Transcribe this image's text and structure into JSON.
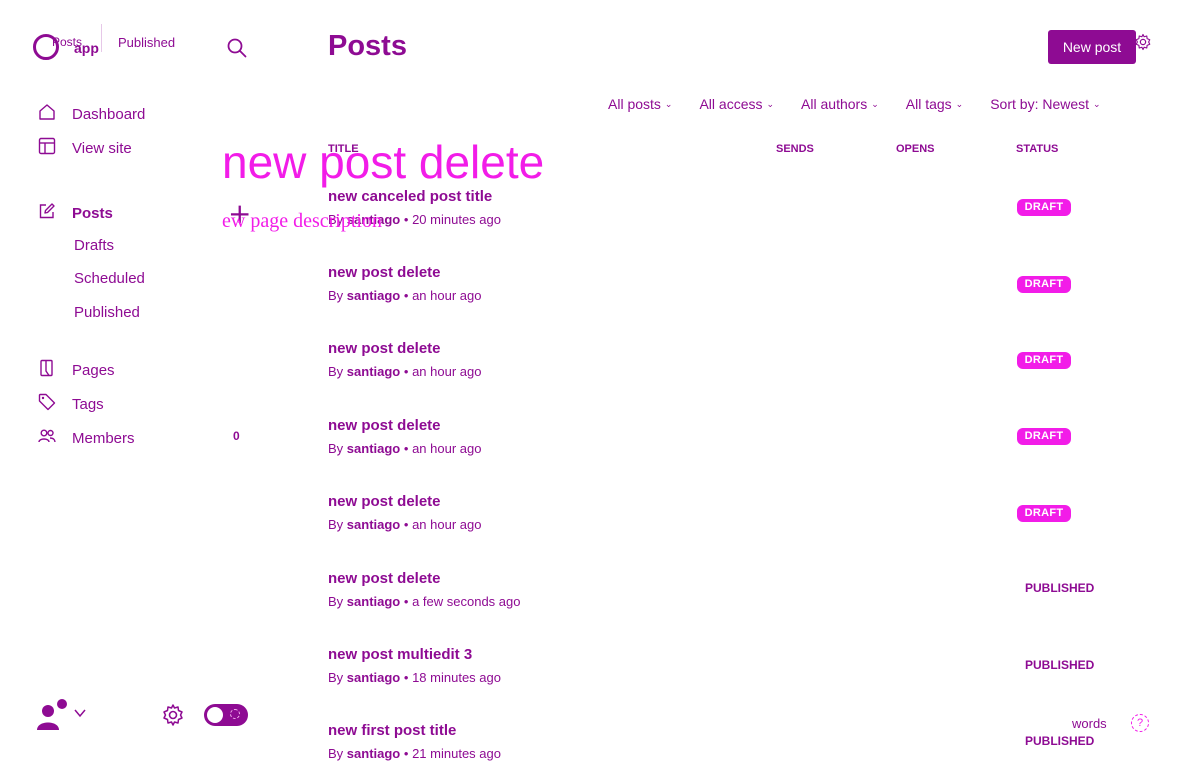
{
  "brand": {
    "app_label": "app",
    "crumb_posts": "Posts",
    "crumb_published": "Published",
    "accent": "#8e0b93",
    "highlight": "#f21ce8"
  },
  "sidebar": {
    "items": [
      {
        "label": "Dashboard",
        "icon": "home-icon"
      },
      {
        "label": "View site",
        "icon": "layout-icon"
      },
      {
        "label": "Posts",
        "icon": "edit-icon"
      },
      {
        "label": "Pages",
        "icon": "page-icon"
      },
      {
        "label": "Tags",
        "icon": "tag-icon"
      },
      {
        "label": "Members",
        "icon": "members-icon",
        "count": "0"
      }
    ],
    "sub_items": [
      "Drafts",
      "Scheduled",
      "Published"
    ]
  },
  "header": {
    "title": "Posts",
    "new_post_label": "New post"
  },
  "filters": [
    "All posts",
    "All access",
    "All authors",
    "All tags",
    "Sort by: Newest"
  ],
  "table": {
    "columns": [
      "TITLE",
      "SENDS",
      "OPENS",
      "STATUS"
    ],
    "rows": [
      {
        "title": "new canceled post title",
        "by": "By",
        "author": "santiago",
        "time": "20 minutes ago",
        "status": "DRAFT"
      },
      {
        "title": "new post delete",
        "by": "By",
        "author": "santiago",
        "time": "an hour ago",
        "status": "DRAFT"
      },
      {
        "title": "new post delete",
        "by": "By",
        "author": "santiago",
        "time": "an hour ago",
        "status": "DRAFT"
      },
      {
        "title": "new post delete",
        "by": "By",
        "author": "santiago",
        "time": "an hour ago",
        "status": "DRAFT"
      },
      {
        "title": "new post delete",
        "by": "By",
        "author": "santiago",
        "time": "an hour ago",
        "status": "DRAFT"
      },
      {
        "title": "new post delete",
        "by": "By",
        "author": "santiago",
        "time": "a few seconds ago",
        "status": "PUBLISHED"
      },
      {
        "title": "new post multiedit 3",
        "by": "By",
        "author": "santiago",
        "time": "18 minutes ago",
        "status": "PUBLISHED"
      },
      {
        "title": "new first post title",
        "by": "By",
        "author": "santiago",
        "time": "21 minutes ago",
        "status": "PUBLISHED"
      }
    ]
  },
  "overlay": {
    "big_text": "new post delete",
    "small_text": "ew page description",
    "plus": "+"
  },
  "footer": {
    "words_label": "words",
    "help_icon": "help-icon"
  },
  "meta_sep": "•"
}
